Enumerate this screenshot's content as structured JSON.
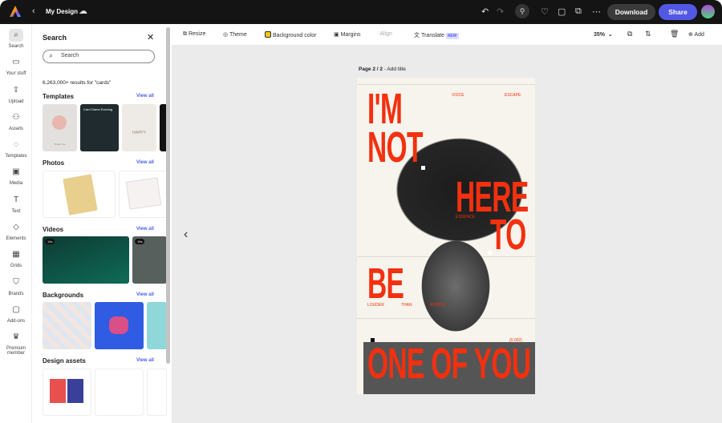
{
  "topbar": {
    "title": "My Design",
    "download": "Download",
    "share": "Share"
  },
  "rail": [
    {
      "label": "Search",
      "icon": "search-icon",
      "g": "⌕"
    },
    {
      "label": "Your stuff",
      "icon": "folder-icon",
      "g": "▭"
    },
    {
      "label": "Upload",
      "icon": "upload-icon",
      "g": "⇪"
    },
    {
      "label": "Assets",
      "icon": "assets-icon",
      "g": "⚇"
    },
    {
      "label": "Templates",
      "icon": "templates-icon",
      "g": "◌"
    },
    {
      "label": "Media",
      "icon": "media-icon",
      "g": "▣"
    },
    {
      "label": "Text",
      "icon": "text-icon",
      "g": "T"
    },
    {
      "label": "Elements",
      "icon": "elements-icon",
      "g": "◇"
    },
    {
      "label": "Grids",
      "icon": "grids-icon",
      "g": "▦"
    },
    {
      "label": "Brands",
      "icon": "brands-icon",
      "g": "⛉"
    },
    {
      "label": "Add-ons",
      "icon": "addons-icon",
      "g": "▢"
    },
    {
      "label": "Premium member",
      "icon": "crown-icon",
      "g": "♛"
    }
  ],
  "panel": {
    "title": "Search",
    "search_placeholder": "Search",
    "results": "6,263,000+ results for \"cards\"",
    "view_all": "View all",
    "sections": [
      "Templates",
      "Photos",
      "Videos",
      "Backgrounds",
      "Design assets"
    ],
    "template_thumb_text": [
      "Thank You",
      "Card Game Evening",
      "HAPPY"
    ],
    "video_durations": [
      "14s",
      "19s"
    ]
  },
  "toolbar": {
    "resize": "Resize",
    "theme": "Theme",
    "background_color": "Background color",
    "margins": "Margins",
    "align": "Align",
    "translate": "Translate",
    "new_badge": "NEW",
    "zoom": "35%",
    "add": "Add",
    "bg_swatch": "#f5c518"
  },
  "canvas": {
    "page_label": "Page 2 / 2",
    "add_title": "- Add title"
  },
  "design": {
    "line1": "I'M",
    "line2": "NOT",
    "line3": "HERE",
    "line4": "TO",
    "line5": "BE",
    "line6": "ONE OF YOU",
    "voice": "VOICE",
    "escape": "ESCAPE",
    "essence": "ESSENCE",
    "louder": "LOUDER",
    "than": "THAN",
    "words": "WORDS",
    "num": "(0.002)",
    "accent": "#f3300f"
  }
}
